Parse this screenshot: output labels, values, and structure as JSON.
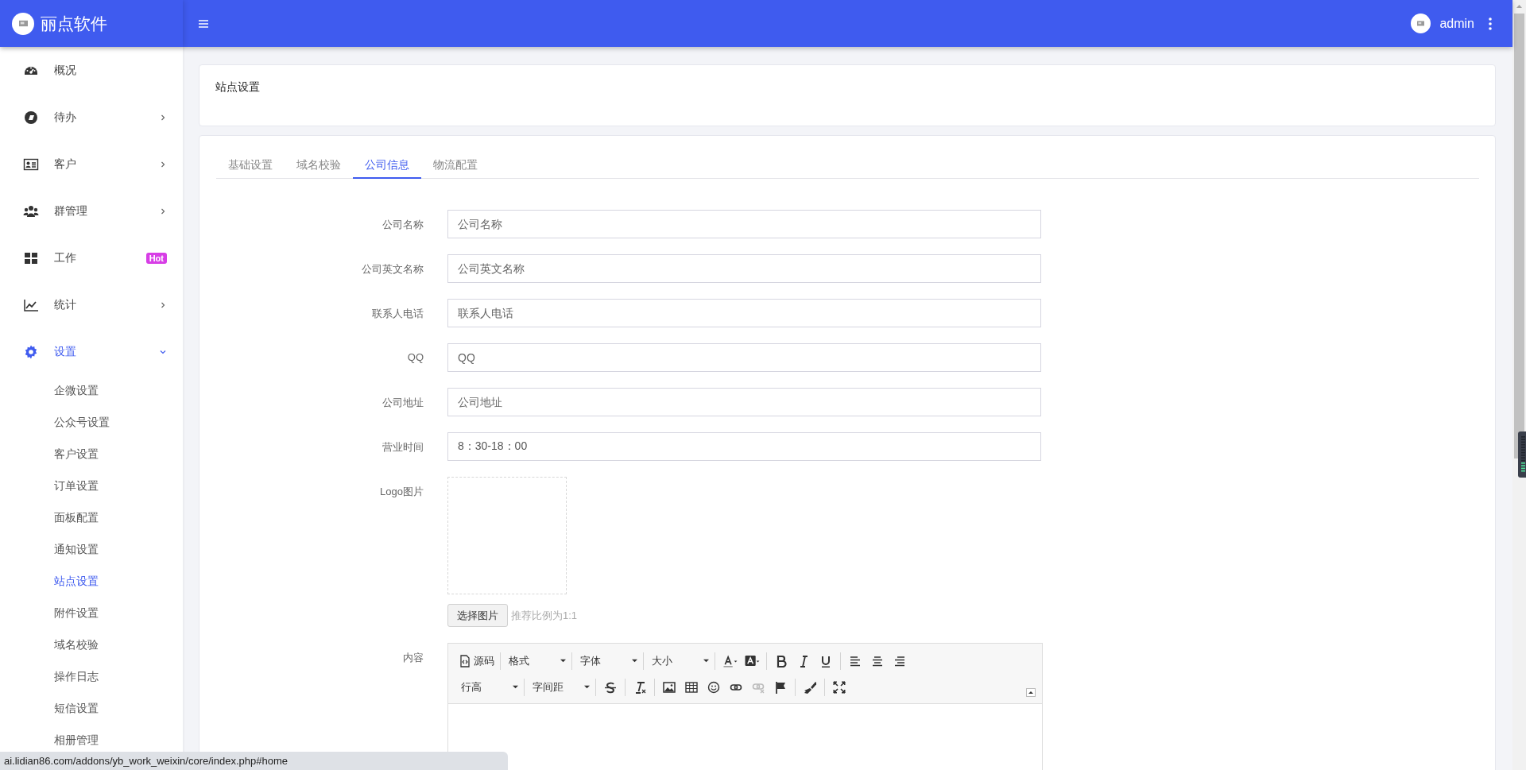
{
  "brand": {
    "name": "丽点软件"
  },
  "user": {
    "name": "admin"
  },
  "sidebar": {
    "items": [
      {
        "label": "概况",
        "kind": "link",
        "selected": false
      },
      {
        "label": "待办",
        "kind": "group",
        "expanded": false,
        "selected": false
      },
      {
        "label": "客户",
        "kind": "group",
        "expanded": false,
        "selected": false
      },
      {
        "label": "群管理",
        "kind": "group",
        "expanded": false,
        "selected": false
      },
      {
        "label": "工作",
        "kind": "link",
        "badge": "Hot",
        "selected": false
      },
      {
        "label": "统计",
        "kind": "group",
        "expanded": false,
        "selected": false
      },
      {
        "label": "设置",
        "kind": "group",
        "expanded": true,
        "selected": true,
        "children": [
          {
            "label": "企微设置",
            "selected": false
          },
          {
            "label": "公众号设置",
            "selected": false
          },
          {
            "label": "客户设置",
            "selected": false
          },
          {
            "label": "订单设置",
            "selected": false
          },
          {
            "label": "面板配置",
            "selected": false
          },
          {
            "label": "通知设置",
            "selected": false
          },
          {
            "label": "站点设置",
            "selected": true
          },
          {
            "label": "附件设置",
            "selected": false
          },
          {
            "label": "域名校验",
            "selected": false
          },
          {
            "label": "操作日志",
            "selected": false
          },
          {
            "label": "短信设置",
            "selected": false
          },
          {
            "label": "相册管理",
            "selected": false
          }
        ]
      }
    ]
  },
  "page_title": "站点设置",
  "tabs": [
    {
      "label": "基础设置",
      "selected": false
    },
    {
      "label": "域名校验",
      "selected": false
    },
    {
      "label": "公司信息",
      "selected": true
    },
    {
      "label": "物流配置",
      "selected": false
    }
  ],
  "form": {
    "fields": [
      {
        "label": "公司名称",
        "placeholder": "公司名称"
      },
      {
        "label": "公司英文名称",
        "placeholder": "公司英文名称"
      },
      {
        "label": "联系人电话",
        "placeholder": "联系人电话"
      },
      {
        "label": "QQ",
        "placeholder": "QQ"
      },
      {
        "label": "公司地址",
        "placeholder": "公司地址"
      },
      {
        "label": "营业时间",
        "value": "8：30-18：00"
      }
    ],
    "logo": {
      "label": "Logo图片",
      "button": "选择图片",
      "hint": "推荐比例为1:1"
    },
    "editor": {
      "label": "内容",
      "toolbar": [
        [
          [
            {
              "kind": "source",
              "label": "源码"
            }
          ],
          [
            {
              "kind": "select",
              "label": "格式"
            }
          ],
          [
            {
              "kind": "select",
              "label": "字体"
            }
          ],
          [
            {
              "kind": "select",
              "label": "大小"
            }
          ],
          [
            {
              "kind": "font-color"
            },
            {
              "kind": "back-color"
            }
          ],
          [
            {
              "kind": "bold"
            },
            {
              "kind": "italic"
            },
            {
              "kind": "underline"
            }
          ],
          [
            {
              "kind": "align-left"
            },
            {
              "kind": "align-center"
            },
            {
              "kind": "align-right"
            }
          ]
        ],
        [
          [
            {
              "kind": "select",
              "label": "行高"
            }
          ],
          [
            {
              "kind": "select",
              "label": "字间距"
            }
          ],
          [
            {
              "kind": "strike"
            }
          ],
          [
            {
              "kind": "clear-format"
            }
          ],
          [
            {
              "kind": "image"
            },
            {
              "kind": "table"
            },
            {
              "kind": "emoji"
            },
            {
              "kind": "link"
            },
            {
              "kind": "unlink",
              "disabled": true
            },
            {
              "kind": "flag"
            }
          ],
          [
            {
              "kind": "brush"
            }
          ],
          [
            {
              "kind": "fullscreen"
            }
          ]
        ]
      ]
    }
  },
  "status_url": "ai.lidian86.com/addons/yb_work_weixin/core/index.php#home"
}
